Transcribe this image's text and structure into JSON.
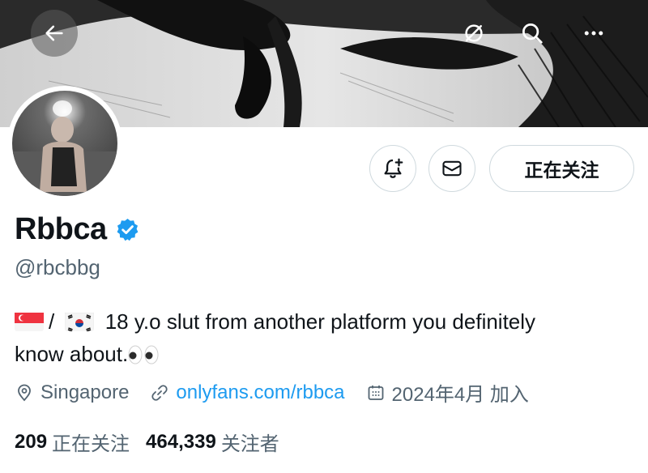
{
  "header": {
    "back_icon": "arrow-left-icon",
    "actions": [
      "refresh-icon",
      "search-icon",
      "more-icon"
    ]
  },
  "profile": {
    "display_name": "Rbbca",
    "handle": "@rbcbbg",
    "verified": true,
    "bio_text_1": "18 y.o slut from another platform you definitely",
    "bio_text_2": "know about.",
    "bio_separator": "/",
    "bio_flags": [
      "singapore-flag",
      "south-korea-flag"
    ],
    "bio_emoji": "eyes-emoji"
  },
  "actions": {
    "notify_icon": "bell-plus-icon",
    "message_icon": "envelope-icon",
    "follow_label": "正在关注"
  },
  "meta": {
    "location": "Singapore",
    "link": "onlyfans.com/rbbca",
    "joined": "2024年4月 加入"
  },
  "stats": {
    "following_count": "209",
    "following_label": "正在关注",
    "followers_count": "464,339",
    "followers_label": "关注者"
  },
  "colors": {
    "link": "#1d9bf0",
    "secondary_text": "#536471",
    "border": "#cfd9de",
    "verified": "#1d9bf0"
  }
}
